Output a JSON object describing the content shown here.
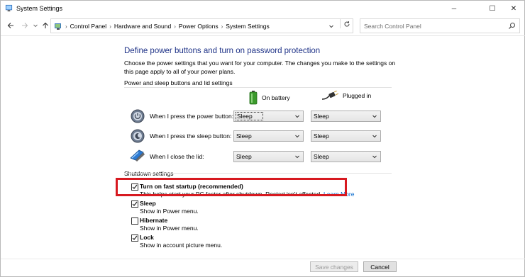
{
  "window": {
    "title": "System Settings",
    "minimize_glyph": "─",
    "maximize_glyph": "☐",
    "close_glyph": "✕"
  },
  "address": {
    "crumbs": [
      "Control Panel",
      "Hardware and Sound",
      "Power Options",
      "System Settings"
    ],
    "separator": "›",
    "search_placeholder": "Search Control Panel"
  },
  "main": {
    "heading": "Define power buttons and turn on password protection",
    "description": "Choose the power settings that you want for your computer. The changes you make to the settings on this page apply to all of your power plans.",
    "section_power": "Power and sleep buttons and lid settings",
    "col_battery": "On battery",
    "col_plugged": "Plugged in",
    "rows": [
      {
        "label": "When I press the power button:",
        "battery": "Sleep",
        "plugged": "Sleep",
        "icon": "power-button-icon"
      },
      {
        "label": "When I press the sleep button:",
        "battery": "Sleep",
        "plugged": "Sleep",
        "icon": "sleep-button-icon"
      },
      {
        "label": "When I close the lid:",
        "battery": "Sleep",
        "plugged": "Sleep",
        "icon": "laptop-lid-icon"
      }
    ],
    "section_shutdown": "Shutdown settings",
    "shutdown": [
      {
        "label": "Turn on fast startup (recommended)",
        "desc": "This helps start your PC faster after shutdown. Restart isn't affected.",
        "link": "Learn More",
        "checked": true
      },
      {
        "label": "Sleep",
        "desc": "Show in Power menu.",
        "checked": true
      },
      {
        "label": "Hibernate",
        "desc": "Show in Power menu.",
        "checked": false
      },
      {
        "label": "Lock",
        "desc": "Show in account picture menu.",
        "checked": true
      }
    ]
  },
  "footer": {
    "save": "Save changes",
    "cancel": "Cancel"
  },
  "colors": {
    "heading": "#1e3287",
    "link": "#0066cc",
    "highlight": "#d71920"
  }
}
